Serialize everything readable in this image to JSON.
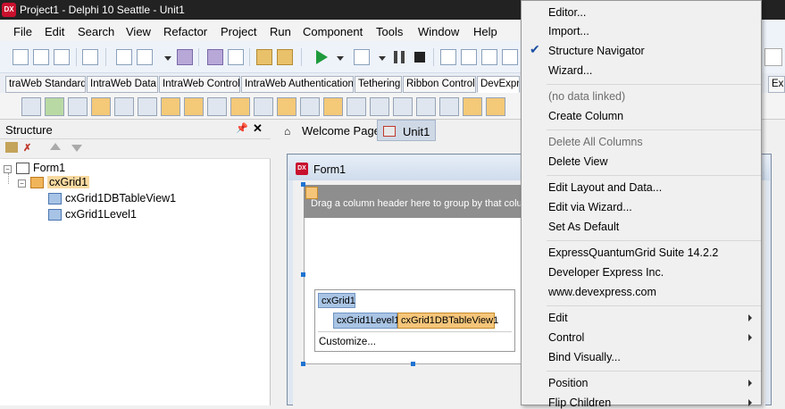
{
  "window": {
    "title": "Project1 - Delphi 10 Seattle - Unit1",
    "app_icon_label": "DX"
  },
  "menubar": {
    "items": [
      "File",
      "Edit",
      "Search",
      "View",
      "Refactor",
      "Project",
      "Run",
      "Component",
      "Tools",
      "Window",
      "Help"
    ]
  },
  "palette_tabs": [
    "traWeb Standard",
    "IntraWeb Data",
    "IntraWeb Control",
    "IntraWeb Authentication",
    "Tethering",
    "Ribbon Controls",
    "DevExpre"
  ],
  "palette_tab_right": "Exp",
  "structure": {
    "title": "Structure",
    "tree": {
      "form": "Form1",
      "grid": "cxGrid1",
      "tableview": "cxGrid1DBTableView1",
      "level": "cxGrid1Level1"
    }
  },
  "designer": {
    "tabs": [
      "Welcome Page",
      "Unit1"
    ],
    "form_title": "Form1",
    "form_icon_label": "DX",
    "groupbar_text": "Drag a column header here to group by that colu",
    "level_box": {
      "grid": "cxGrid1",
      "level": "cxGrid1Level1",
      "view": "cxGrid1DBTableView1",
      "customize": "Customize..."
    }
  },
  "context_menu": {
    "group1": [
      "Editor...",
      "Import...",
      "Structure Navigator",
      "Wizard..."
    ],
    "checked_item": "Structure Navigator",
    "group2": [
      "(no data linked)",
      "Create Column"
    ],
    "group3": [
      "Delete All Columns",
      "Delete View"
    ],
    "group4": [
      "Edit Layout and Data...",
      "Edit via Wizard...",
      "Set As Default"
    ],
    "group5": [
      "ExpressQuantumGrid Suite 14.2.2",
      "Developer Express Inc.",
      "www.devexpress.com"
    ],
    "group6": [
      "Edit",
      "Control",
      "Bind Visually..."
    ],
    "group7": [
      "Position",
      "Flip Children"
    ]
  },
  "colors": {
    "accent": "#1e73d2",
    "selected_node": "#f8d9a0",
    "view_highlight": "#f5c57a",
    "title_bar": "#222222"
  }
}
